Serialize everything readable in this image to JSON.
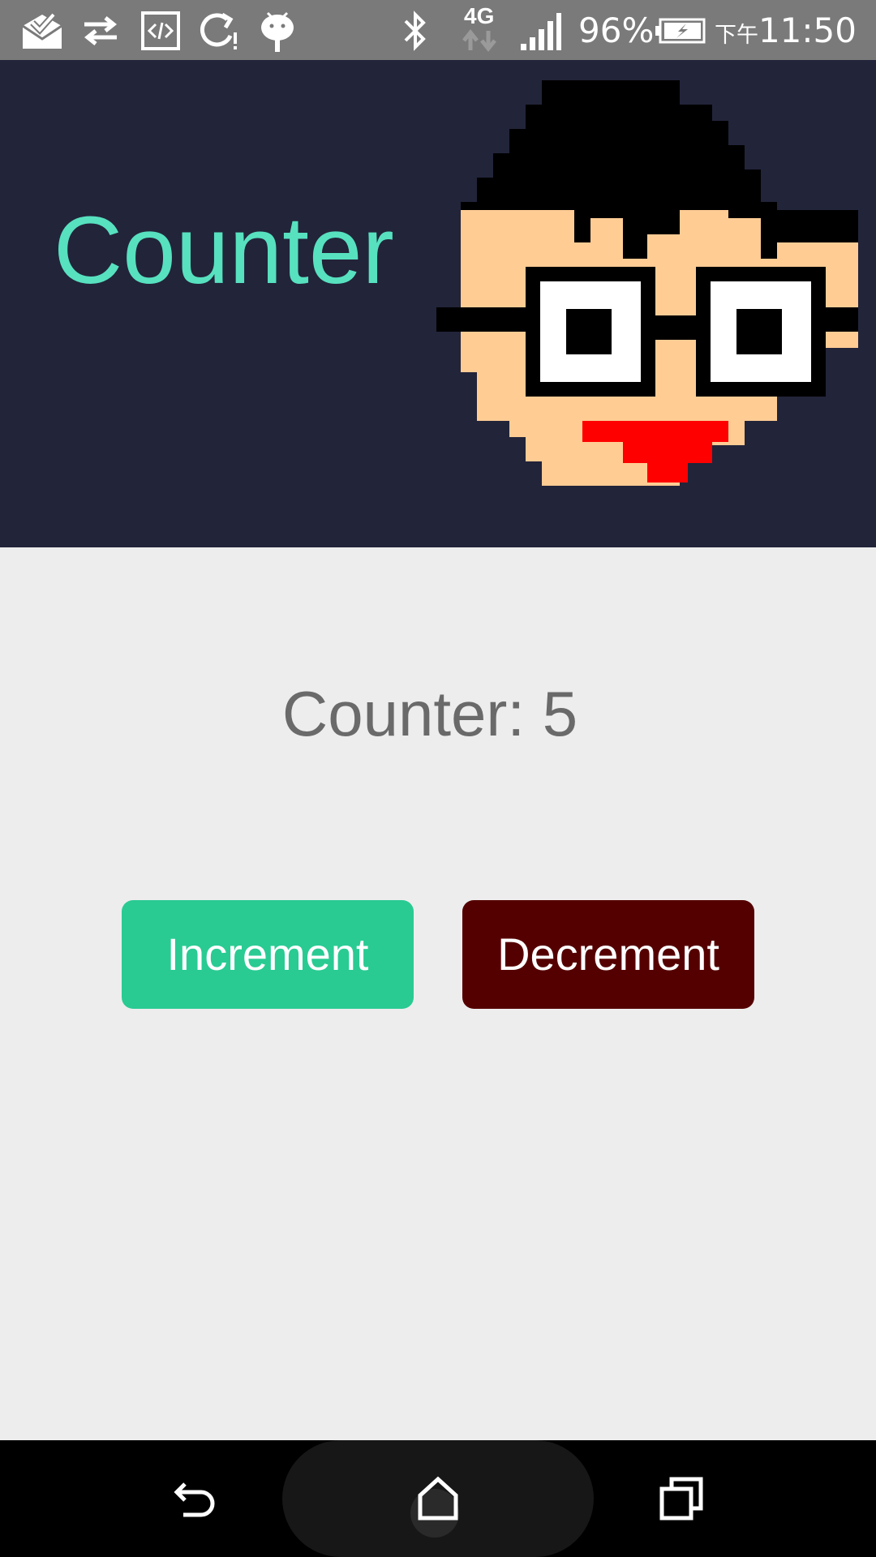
{
  "status_bar": {
    "icons": [
      "mail-check-icon",
      "transfer-arrows-icon",
      "code-icon",
      "sync-alert-icon",
      "android-icon",
      "bluetooth-icon",
      "network-4g-icon",
      "signal-icon",
      "battery-charging-icon"
    ],
    "network_label": "4G",
    "battery_percent": "96%",
    "time_prefix": "下午",
    "time": "11:50"
  },
  "header": {
    "title": "Counter",
    "background": "#22243a",
    "title_color": "#57e1bf"
  },
  "main": {
    "counter_text": "Counter: 5",
    "counter_value": 5,
    "increment_label": "Increment",
    "decrement_label": "Decrement",
    "increment_color": "#29cb93",
    "decrement_color": "#550000",
    "background": "#ededed"
  },
  "nav_bar": {
    "icons": [
      "back-icon",
      "home-icon",
      "recents-icon"
    ]
  }
}
